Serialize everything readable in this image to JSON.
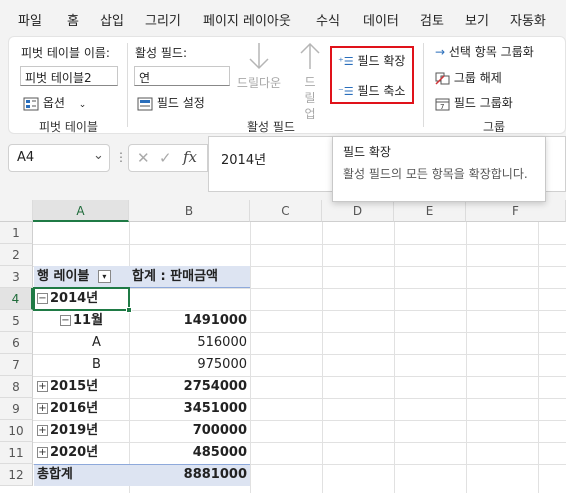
{
  "menu": {
    "tabs": [
      "파일",
      "홈",
      "삽입",
      "그리기",
      "페이지 레이아웃",
      "수식",
      "데이터",
      "검토",
      "보기",
      "자동화"
    ]
  },
  "ribbon": {
    "pivot_table": {
      "name_label": "피벗 테이블 이름:",
      "name_value": "피벗 테이블2",
      "options_label": "옵션",
      "group_label": "피벗 테이블"
    },
    "active_field": {
      "field_label": "활성 필드:",
      "field_value": "연",
      "settings_label": "필드 설정",
      "drilldown_label": "드릴다운",
      "drillup_label": "드릴 업",
      "expand_label": "필드 확장",
      "collapse_label": "필드 축소",
      "group_label": "활성 필드"
    },
    "group": {
      "group_selection_label": "선택 항목 그룹화",
      "ungroup_label": "그룹 해제",
      "group_field_label": "필드 그룹화",
      "group_label": "그룹"
    }
  },
  "formula_bar": {
    "name_box": "A4",
    "fx": "fx",
    "formula": "2014년"
  },
  "tooltip": {
    "title": "필드 확장",
    "body": "활성 필드의 모든 항목을 확장합니다."
  },
  "grid": {
    "columns": [
      "A",
      "B",
      "C",
      "D",
      "E",
      "F"
    ],
    "rows": [
      "1",
      "2",
      "3",
      "4",
      "5",
      "6",
      "7",
      "8",
      "9",
      "10",
      "11",
      "12"
    ],
    "header_row_label": "행 레이블",
    "header_value": "합계 : 판매금액",
    "r4_label": "2014년",
    "r5_label": "11월",
    "r5_value": "1491000",
    "r6_label": "A",
    "r6_value": "516000",
    "r7_label": "B",
    "r7_value": "975000",
    "r8_label": "2015년",
    "r8_value": "2754000",
    "r9_label": "2016년",
    "r9_value": "3451000",
    "r10_label": "2019년",
    "r10_value": "700000",
    "r11_label": "2020년",
    "r11_value": "485000",
    "total_label": "총합계",
    "total_value": "8881000"
  },
  "colors": {
    "excel_green": "#1f7a45",
    "highlight_red": "#e0121a",
    "pivot_header_fill": "#dde4f2"
  }
}
